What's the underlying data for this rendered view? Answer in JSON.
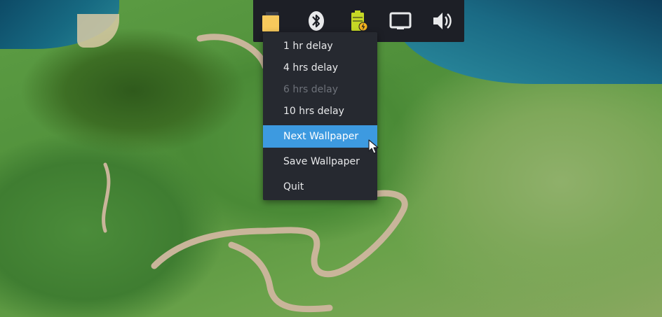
{
  "tray": {
    "icons": [
      "wallpaper-app-icon",
      "bluetooth-icon",
      "battery-charging-icon",
      "display-icon",
      "volume-icon"
    ]
  },
  "menu": {
    "items": [
      {
        "label": "1 hr delay",
        "enabled": true,
        "highlighted": false
      },
      {
        "label": "4 hrs delay",
        "enabled": true,
        "highlighted": false
      },
      {
        "label": "6 hrs delay",
        "enabled": false,
        "highlighted": false
      },
      {
        "label": "10 hrs delay",
        "enabled": true,
        "highlighted": false
      },
      {
        "label": "Next Wallpaper",
        "enabled": true,
        "highlighted": true
      },
      {
        "label": "Save Wallpaper",
        "enabled": true,
        "highlighted": false
      },
      {
        "label": "Quit",
        "enabled": true,
        "highlighted": false
      }
    ]
  },
  "colors": {
    "panel_bg": "#1d1f26",
    "menu_bg": "#262930",
    "highlight": "#3d9ae0",
    "disabled_text": "#6e727a",
    "battery": "#c6d825"
  }
}
